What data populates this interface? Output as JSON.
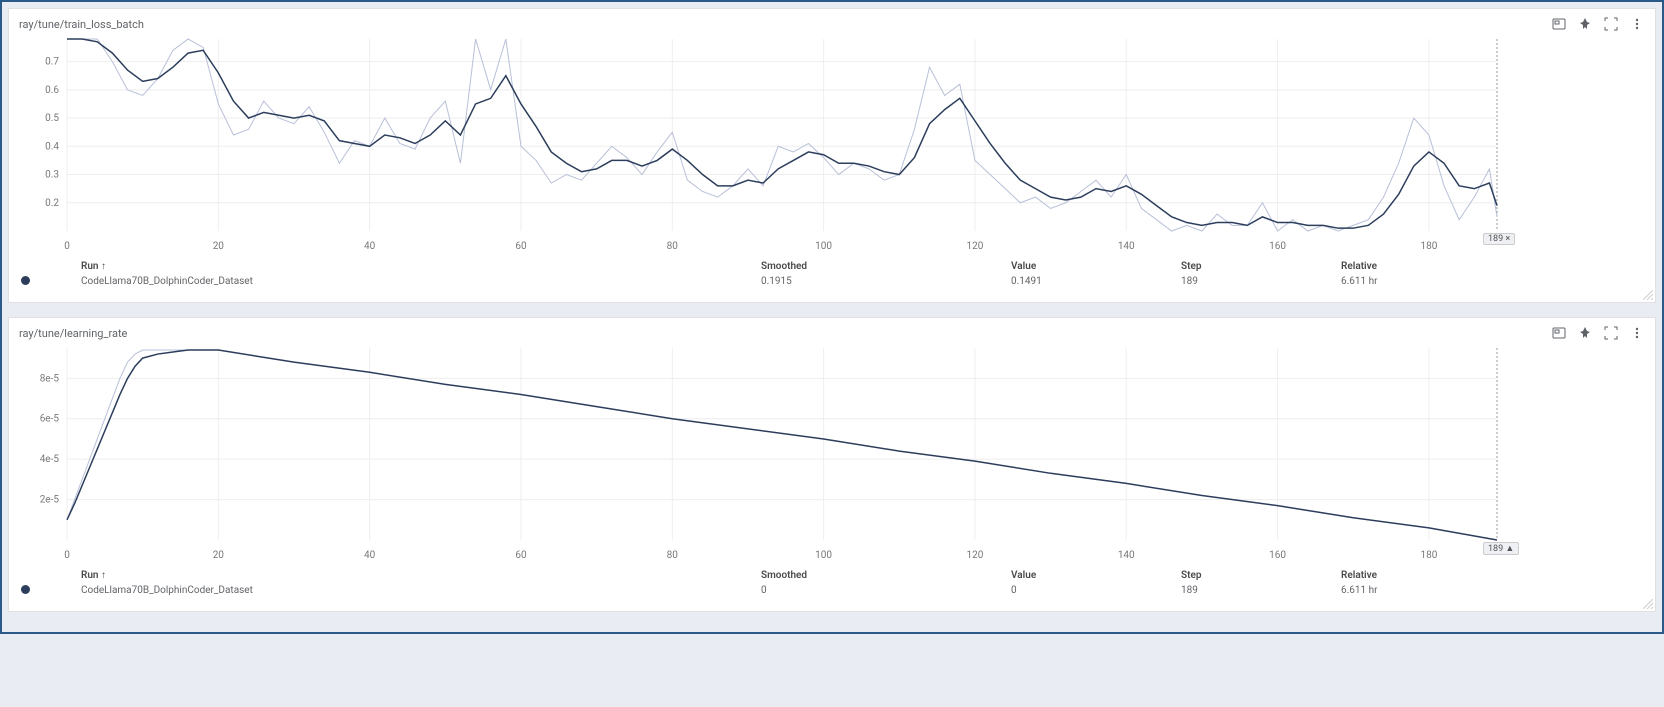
{
  "panels": [
    {
      "title": "ray/tune/train_loss_batch",
      "step_badge": "189 ×",
      "legend": {
        "headers": {
          "run": "Run ↑",
          "smoothed": "Smoothed",
          "value": "Value",
          "step": "Step",
          "relative": "Relative"
        },
        "row": {
          "run": "CodeLlama70B_DolphinCoder_Dataset",
          "smoothed": "0.1915",
          "value": "0.1491",
          "step": "189",
          "relative": "6.611 hr"
        }
      }
    },
    {
      "title": "ray/tune/learning_rate",
      "step_badge": "189 ▲",
      "legend": {
        "headers": {
          "run": "Run ↑",
          "smoothed": "Smoothed",
          "value": "Value",
          "step": "Step",
          "relative": "Relative"
        },
        "row": {
          "run": "CodeLlama70B_DolphinCoder_Dataset",
          "smoothed": "0",
          "value": "0",
          "step": "189",
          "relative": "6.611 hr"
        }
      }
    }
  ],
  "chart_data": [
    {
      "type": "line",
      "title": "ray/tune/train_loss_batch",
      "xlabel": "",
      "ylabel": "",
      "xlim": [
        0,
        189
      ],
      "ylim": [
        0.1,
        0.78
      ],
      "x_ticks": [
        0,
        20,
        40,
        60,
        80,
        100,
        120,
        140,
        160,
        180
      ],
      "y_ticks": [
        0.2,
        0.3,
        0.4,
        0.5,
        0.6,
        0.7
      ],
      "x": [
        0,
        2,
        4,
        6,
        8,
        10,
        12,
        14,
        16,
        18,
        20,
        22,
        24,
        26,
        28,
        30,
        32,
        34,
        36,
        38,
        40,
        42,
        44,
        46,
        48,
        50,
        52,
        54,
        56,
        58,
        60,
        62,
        64,
        66,
        68,
        70,
        72,
        74,
        76,
        78,
        80,
        82,
        84,
        86,
        88,
        90,
        92,
        94,
        96,
        98,
        100,
        102,
        104,
        106,
        108,
        110,
        112,
        114,
        116,
        118,
        120,
        122,
        124,
        126,
        128,
        130,
        132,
        134,
        136,
        138,
        140,
        142,
        144,
        146,
        148,
        150,
        152,
        154,
        156,
        158,
        160,
        162,
        164,
        166,
        168,
        170,
        172,
        174,
        176,
        178,
        180,
        182,
        184,
        186,
        188,
        189
      ],
      "series": [
        {
          "name": "raw",
          "values": [
            0.78,
            0.78,
            0.78,
            0.7,
            0.6,
            0.58,
            0.64,
            0.74,
            0.78,
            0.75,
            0.55,
            0.44,
            0.46,
            0.56,
            0.5,
            0.48,
            0.54,
            0.45,
            0.34,
            0.42,
            0.4,
            0.5,
            0.41,
            0.39,
            0.5,
            0.56,
            0.34,
            0.78,
            0.6,
            0.78,
            0.4,
            0.35,
            0.27,
            0.3,
            0.28,
            0.34,
            0.4,
            0.36,
            0.3,
            0.38,
            0.45,
            0.28,
            0.24,
            0.22,
            0.26,
            0.32,
            0.26,
            0.4,
            0.38,
            0.41,
            0.36,
            0.3,
            0.34,
            0.32,
            0.28,
            0.3,
            0.46,
            0.68,
            0.58,
            0.62,
            0.35,
            0.3,
            0.25,
            0.2,
            0.22,
            0.18,
            0.2,
            0.24,
            0.28,
            0.22,
            0.3,
            0.18,
            0.14,
            0.1,
            0.12,
            0.1,
            0.16,
            0.12,
            0.12,
            0.2,
            0.1,
            0.14,
            0.1,
            0.12,
            0.1,
            0.12,
            0.14,
            0.22,
            0.34,
            0.5,
            0.44,
            0.26,
            0.14,
            0.22,
            0.32,
            0.15
          ],
          "color": "#b8c0d8"
        },
        {
          "name": "smoothed",
          "values": [
            0.78,
            0.78,
            0.77,
            0.73,
            0.67,
            0.63,
            0.64,
            0.68,
            0.73,
            0.74,
            0.66,
            0.56,
            0.5,
            0.52,
            0.51,
            0.5,
            0.51,
            0.49,
            0.42,
            0.41,
            0.4,
            0.44,
            0.43,
            0.41,
            0.44,
            0.49,
            0.44,
            0.55,
            0.57,
            0.65,
            0.55,
            0.47,
            0.38,
            0.34,
            0.31,
            0.32,
            0.35,
            0.35,
            0.33,
            0.35,
            0.39,
            0.35,
            0.3,
            0.26,
            0.26,
            0.28,
            0.27,
            0.32,
            0.35,
            0.38,
            0.37,
            0.34,
            0.34,
            0.33,
            0.31,
            0.3,
            0.36,
            0.48,
            0.53,
            0.57,
            0.49,
            0.41,
            0.34,
            0.28,
            0.25,
            0.22,
            0.21,
            0.22,
            0.25,
            0.24,
            0.26,
            0.23,
            0.19,
            0.15,
            0.13,
            0.12,
            0.13,
            0.13,
            0.12,
            0.15,
            0.13,
            0.13,
            0.12,
            0.12,
            0.11,
            0.11,
            0.12,
            0.16,
            0.23,
            0.33,
            0.38,
            0.34,
            0.26,
            0.25,
            0.27,
            0.19
          ],
          "color": "#2c3e5c"
        }
      ],
      "step_marker": 189
    },
    {
      "type": "line",
      "title": "ray/tune/learning_rate",
      "xlabel": "",
      "ylabel": "",
      "xlim": [
        0,
        189
      ],
      "ylim": [
        0,
        9.5e-05
      ],
      "x_ticks": [
        0,
        20,
        40,
        60,
        80,
        100,
        120,
        140,
        160,
        180
      ],
      "y_ticks_labels": [
        "2e-5",
        "4e-5",
        "6e-5",
        "8e-5"
      ],
      "y_ticks": [
        2e-05,
        4e-05,
        6e-05,
        8e-05
      ],
      "x": [
        0,
        1,
        2,
        3,
        4,
        5,
        6,
        7,
        8,
        9,
        10,
        12,
        14,
        16,
        18,
        20,
        25,
        30,
        40,
        50,
        60,
        70,
        80,
        90,
        100,
        110,
        120,
        130,
        140,
        150,
        160,
        170,
        180,
        189
      ],
      "series": [
        {
          "name": "raw",
          "values": [
            1e-05,
            2e-05,
            3e-05,
            4e-05,
            5e-05,
            6e-05,
            7e-05,
            8e-05,
            8.8e-05,
            9.2e-05,
            9.4e-05,
            9.4e-05,
            9.4e-05,
            9.4e-05,
            9.4e-05,
            9.4e-05,
            9.1e-05,
            8.8e-05,
            8.3e-05,
            7.7e-05,
            7.2e-05,
            6.6e-05,
            6e-05,
            5.5e-05,
            5e-05,
            4.4e-05,
            3.9e-05,
            3.3e-05,
            2.8e-05,
            2.2e-05,
            1.7e-05,
            1.1e-05,
            6e-06,
            0.0
          ],
          "color": "#b8c0d8"
        },
        {
          "name": "smoothed",
          "values": [
            1e-05,
            1.8e-05,
            2.7e-05,
            3.6e-05,
            4.5e-05,
            5.4e-05,
            6.3e-05,
            7.2e-05,
            8e-05,
            8.6e-05,
            9e-05,
            9.2e-05,
            9.3e-05,
            9.4e-05,
            9.4e-05,
            9.4e-05,
            9.1e-05,
            8.8e-05,
            8.3e-05,
            7.7e-05,
            7.2e-05,
            6.6e-05,
            6e-05,
            5.5e-05,
            5e-05,
            4.4e-05,
            3.9e-05,
            3.3e-05,
            2.8e-05,
            2.2e-05,
            1.7e-05,
            1.1e-05,
            6e-06,
            0.0
          ],
          "color": "#2c3e5c"
        }
      ],
      "step_marker": 189
    }
  ]
}
